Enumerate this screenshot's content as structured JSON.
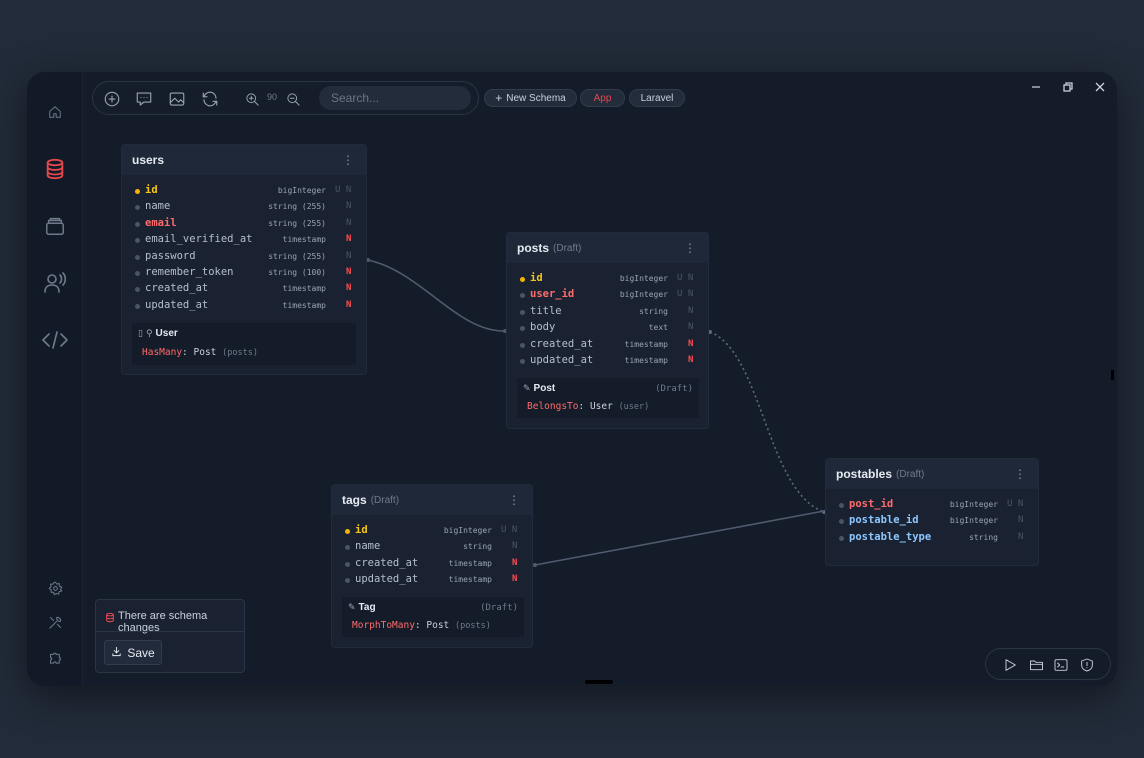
{
  "toolbar": {
    "zoom": "90",
    "search_placeholder": "Search...",
    "new_schema_label": "New Schema",
    "schemas": [
      "App",
      "Laravel"
    ]
  },
  "tables": {
    "users": {
      "name": "users",
      "columns": [
        {
          "name": "id",
          "type": "bigInteger",
          "flags": "U N",
          "kind": "pk"
        },
        {
          "name": "name",
          "type": "string (255)",
          "flags": "N",
          "kind": ""
        },
        {
          "name": "email",
          "type": "string (255)",
          "flags": "N",
          "kind": "fk"
        },
        {
          "name": "email_verified_at",
          "type": "timestamp",
          "flags": "N",
          "kind": "",
          "nullable": true
        },
        {
          "name": "password",
          "type": "string (255)",
          "flags": "N",
          "kind": ""
        },
        {
          "name": "remember_token",
          "type": "string (100)",
          "flags": "N",
          "kind": "",
          "nullable": true
        },
        {
          "name": "created_at",
          "type": "timestamp",
          "flags": "N",
          "kind": "",
          "nullable": true
        },
        {
          "name": "updated_at",
          "type": "timestamp",
          "flags": "N",
          "kind": "",
          "nullable": true
        }
      ],
      "model": {
        "name": "User",
        "relation": "HasMany",
        "target": "Post",
        "target_table": "(posts)"
      }
    },
    "posts": {
      "name": "posts",
      "draft": "(Draft)",
      "columns": [
        {
          "name": "id",
          "type": "bigInteger",
          "flags": "U N",
          "kind": "pk"
        },
        {
          "name": "user_id",
          "type": "bigInteger",
          "flags": "U N",
          "kind": "fk"
        },
        {
          "name": "title",
          "type": "string",
          "flags": "N",
          "kind": ""
        },
        {
          "name": "body",
          "type": "text",
          "flags": "N",
          "kind": ""
        },
        {
          "name": "created_at",
          "type": "timestamp",
          "flags": "N",
          "kind": "",
          "nullable": true
        },
        {
          "name": "updated_at",
          "type": "timestamp",
          "flags": "N",
          "kind": "",
          "nullable": true
        }
      ],
      "model": {
        "name": "Post",
        "draft": "(Draft)",
        "relation": "BelongsTo",
        "target": "User",
        "target_table": "(user)"
      }
    },
    "tags": {
      "name": "tags",
      "draft": "(Draft)",
      "columns": [
        {
          "name": "id",
          "type": "bigInteger",
          "flags": "U N",
          "kind": "pk"
        },
        {
          "name": "name",
          "type": "string",
          "flags": "N",
          "kind": ""
        },
        {
          "name": "created_at",
          "type": "timestamp",
          "flags": "N",
          "kind": "",
          "nullable": true
        },
        {
          "name": "updated_at",
          "type": "timestamp",
          "flags": "N",
          "kind": "",
          "nullable": true
        }
      ],
      "model": {
        "name": "Tag",
        "draft": "(Draft)",
        "relation": "MorphToMany",
        "target": "Post",
        "target_table": "(posts)"
      }
    },
    "postables": {
      "name": "postables",
      "draft": "(Draft)",
      "columns": [
        {
          "name": "post_id",
          "type": "bigInteger",
          "flags": "U N",
          "kind": "fk"
        },
        {
          "name": "postable_id",
          "type": "bigInteger",
          "flags": "N",
          "kind": "mk"
        },
        {
          "name": "postable_type",
          "type": "string",
          "flags": "N",
          "kind": "mk"
        }
      ]
    }
  },
  "notice": {
    "text": "There are schema changes",
    "save_label": "Save"
  },
  "colors": {
    "accent": "#e5484d",
    "primary_key": "#f5c518",
    "foreign_key": "#ff6b6b",
    "morph_key": "#8cc8ff",
    "background": "#141b29"
  }
}
